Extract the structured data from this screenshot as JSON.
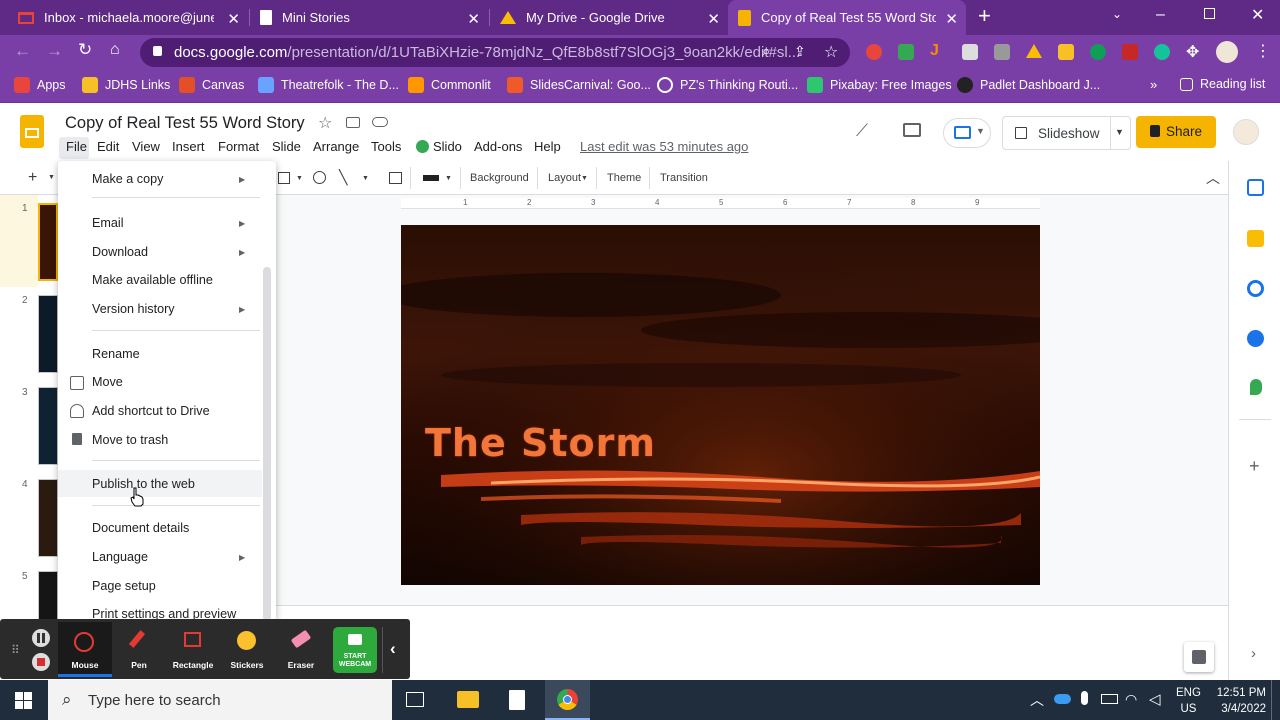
{
  "browser": {
    "tabs": [
      {
        "title": "Inbox - michaela.moore@juneau",
        "icon": "gmail-icon",
        "active": false
      },
      {
        "title": "Mini Stories",
        "icon": "doc-icon",
        "active": false
      },
      {
        "title": "My Drive - Google Drive",
        "icon": "drive-icon",
        "active": false
      },
      {
        "title": "Copy of Real Test 55 Word Story",
        "icon": "slides-icon",
        "active": true
      }
    ],
    "url_host": "docs.google.com",
    "url_path": "/presentation/d/1UTaBiXHzie-78mjdNz_QfE8b8stf7SlOGj3_9oan2kk/edit#sl...",
    "bookmarks": [
      {
        "label": "Apps",
        "color": "#e8453c"
      },
      {
        "label": "JDHS Links",
        "color": "#f6c026"
      },
      {
        "label": "Canvas",
        "color": "#e34f26"
      },
      {
        "label": "Theatrefolk - The D...",
        "color": "#6aa3ff"
      },
      {
        "label": "Commonlit",
        "color": "#ff9800"
      },
      {
        "label": "SlidesCarnival: Goo...",
        "color": "#f05a28"
      },
      {
        "label": "PZ's Thinking Routi...",
        "color": "#ffffff"
      },
      {
        "label": "Pixabay: Free Images",
        "color": "#2ec66e"
      },
      {
        "label": "Padlet Dashboard J...",
        "color": "#222222"
      }
    ],
    "reading_list": "Reading list"
  },
  "docs": {
    "title": "Copy of Real Test 55 Word Story",
    "menu": [
      "File",
      "Edit",
      "View",
      "Insert",
      "Format",
      "Slide",
      "Arrange",
      "Tools",
      "Slido",
      "Add-ons",
      "Help"
    ],
    "last_edit": "Last edit was 53 minutes ago",
    "slideshow_label": "Slideshow",
    "share_label": "Share",
    "accent": "#f4b400",
    "toolbar": {
      "background": "Background",
      "layout": "Layout",
      "theme": "Theme",
      "transition": "Transition"
    },
    "ruler_numbers": [
      "1",
      "2",
      "3",
      "4",
      "5",
      "6",
      "7",
      "8",
      "9"
    ],
    "slide_numbers": [
      "1",
      "2",
      "3",
      "4",
      "5"
    ],
    "slide_title": "The Storm"
  },
  "file_menu": {
    "items": [
      {
        "label": "Make a copy",
        "submenu": true
      },
      {
        "label": "Email",
        "submenu": true
      },
      {
        "label": "Download",
        "submenu": true
      },
      {
        "label": "Make available offline",
        "submenu": false
      },
      {
        "label": "Version history",
        "submenu": true
      },
      {
        "label": "Rename",
        "submenu": false
      },
      {
        "label": "Move",
        "submenu": false,
        "icon": "folder-move-icon"
      },
      {
        "label": "Add shortcut to Drive",
        "submenu": false,
        "icon": "drive-shortcut-icon"
      },
      {
        "label": "Move to trash",
        "submenu": false,
        "icon": "trash-icon"
      },
      {
        "label": "Publish to the web",
        "submenu": false,
        "hovered": true
      },
      {
        "label": "Document details",
        "submenu": false
      },
      {
        "label": "Language",
        "submenu": true
      },
      {
        "label": "Page setup",
        "submenu": false
      },
      {
        "label": "Print settings and preview",
        "submenu": false
      }
    ]
  },
  "recorder": {
    "tools": [
      "Mouse",
      "Pen",
      "Rectangle",
      "Stickers",
      "Eraser"
    ],
    "webcam": "START WEBCAM"
  },
  "taskbar": {
    "search_placeholder": "Type here to search",
    "lang_top": "ENG",
    "lang_bottom": "US",
    "time": "12:51 PM",
    "date": "3/4/2022"
  }
}
